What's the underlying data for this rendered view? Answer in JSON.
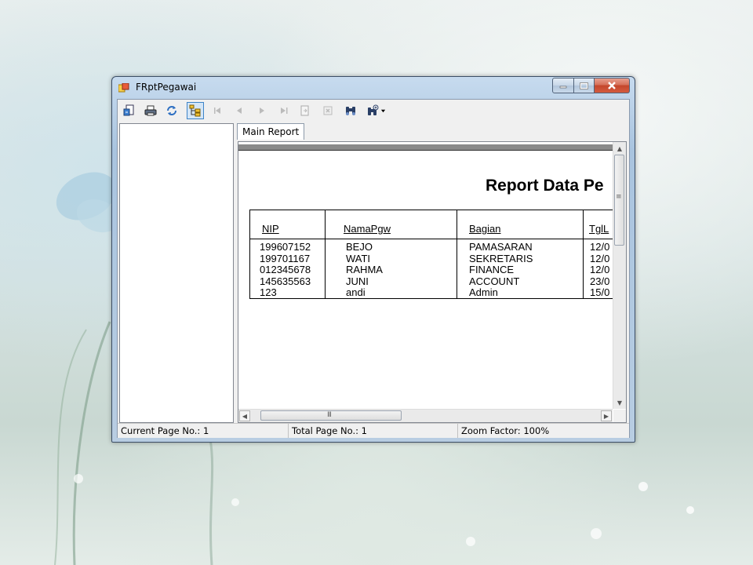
{
  "window": {
    "title": "FRptPegawai",
    "icon": "report-app-icon"
  },
  "toolbar": {
    "buttons": [
      {
        "name": "export-report-button",
        "icon": "export-icon",
        "enabled": true
      },
      {
        "name": "print-report-button",
        "icon": "print-icon",
        "enabled": true
      },
      {
        "name": "refresh-button",
        "icon": "refresh-icon",
        "enabled": true
      },
      {
        "name": "toggle-group-tree-button",
        "icon": "group-tree-icon",
        "enabled": true,
        "active": true
      },
      {
        "name": "first-page-button",
        "icon": "first-page-icon",
        "enabled": false
      },
      {
        "name": "previous-page-button",
        "icon": "previous-page-icon",
        "enabled": false
      },
      {
        "name": "next-page-button",
        "icon": "next-page-icon",
        "enabled": false
      },
      {
        "name": "last-page-button",
        "icon": "last-page-icon",
        "enabled": false
      },
      {
        "name": "go-to-page-button",
        "icon": "go-to-page-icon",
        "enabled": false
      },
      {
        "name": "stop-button",
        "icon": "stop-icon",
        "enabled": false
      },
      {
        "name": "find-text-button",
        "icon": "binoculars-icon",
        "enabled": true
      },
      {
        "name": "zoom-button",
        "icon": "zoom-icon",
        "enabled": true
      }
    ]
  },
  "tabs": [
    {
      "label": "Main Report"
    }
  ],
  "report": {
    "title": "Report Data Pe",
    "headers": [
      "NIP",
      "NamaPgw",
      "Bagian",
      "TglL"
    ],
    "rows": [
      [
        "199607152",
        "BEJO",
        "PAMASARAN",
        "12/0"
      ],
      [
        "199701167",
        "WATI",
        "SEKRETARIS",
        "12/0"
      ],
      [
        "012345678",
        "RAHMA",
        "FINANCE",
        "12/0"
      ],
      [
        "145635563",
        "JUNI",
        "ACCOUNT",
        "23/0"
      ],
      [
        "123",
        "andi",
        "Admin",
        "15/0"
      ]
    ]
  },
  "scrollbars": {
    "horizontal_grip": "III",
    "vertical_grip": "≡"
  },
  "status": {
    "current_page": "Current Page No.: 1",
    "total_page": "Total Page No.: 1",
    "zoom": "Zoom Factor: 100%"
  },
  "colors": {
    "title_bar": "#b9d1ea",
    "close_button": "#c9452b",
    "page_bar": "#8a8a8a"
  }
}
